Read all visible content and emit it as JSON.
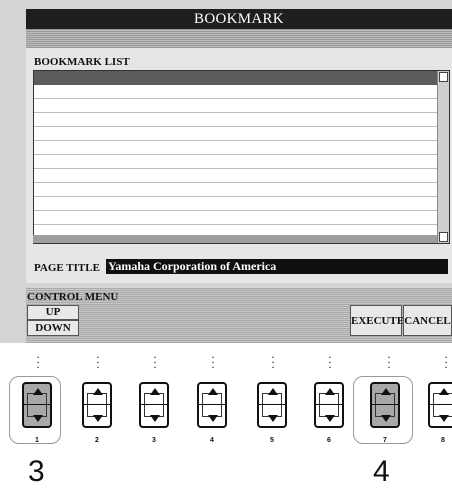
{
  "screen": {
    "title": "BOOKMARK",
    "list_label": "BOOKMARK LIST",
    "list_rows": [
      "",
      "",
      "",
      "",
      "",
      "",
      "",
      "",
      "",
      "",
      "",
      ""
    ],
    "page_title_label": "PAGE TITLE",
    "page_title_value": "Yamaha Corporation of America",
    "control_menu_label": "CONTROL MENU",
    "buttons": {
      "up": "UP",
      "down": "DOWN",
      "execute": "EXECUTE",
      "cancel": "CANCEL"
    }
  },
  "panel": {
    "buttons": [
      {
        "number": "1",
        "highlighted": true
      },
      {
        "number": "2",
        "highlighted": false
      },
      {
        "number": "3",
        "highlighted": false
      },
      {
        "number": "4",
        "highlighted": false
      },
      {
        "number": "5",
        "highlighted": false
      },
      {
        "number": "6",
        "highlighted": false
      },
      {
        "number": "7",
        "highlighted": true
      },
      {
        "number": "8",
        "highlighted": false
      }
    ],
    "callouts": [
      "3",
      "4"
    ]
  },
  "colors": {
    "title_bar": "#1e1e1e",
    "selected_row": "#5c5c5c",
    "highlight_button": "#a8a8a8"
  }
}
